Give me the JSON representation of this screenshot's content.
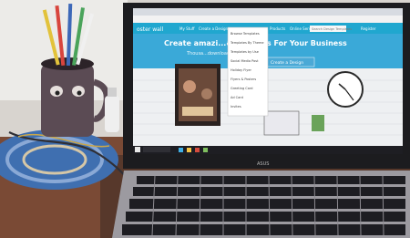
{
  "site": {
    "logo_left": "oster",
    "logo_right": "wall",
    "nav_items": [
      "My Stuff",
      "Create a Design",
      "Products",
      "Online Services",
      "Search Design Templates"
    ],
    "header_right": "Register",
    "hero_title": "Create amazi...& Graphics For Your Business",
    "hero_subtitle": "Thousa...downloads and easy tools!",
    "cta_label": "Create a Design"
  },
  "dropdown": {
    "items": [
      "Browse Templates",
      "Templates By Theme",
      "Templates by Use",
      "Social Media Post",
      "Holiday Flyer",
      "Flyers & Posters",
      "Greeting Card",
      "Ad Card",
      "Invites"
    ]
  },
  "keyboard_brand": "ASUS",
  "colors": {
    "screen_blue": "#3aa9d8",
    "cta_blue": "#4aa9d6",
    "desk_wood": "#7a4a35"
  }
}
